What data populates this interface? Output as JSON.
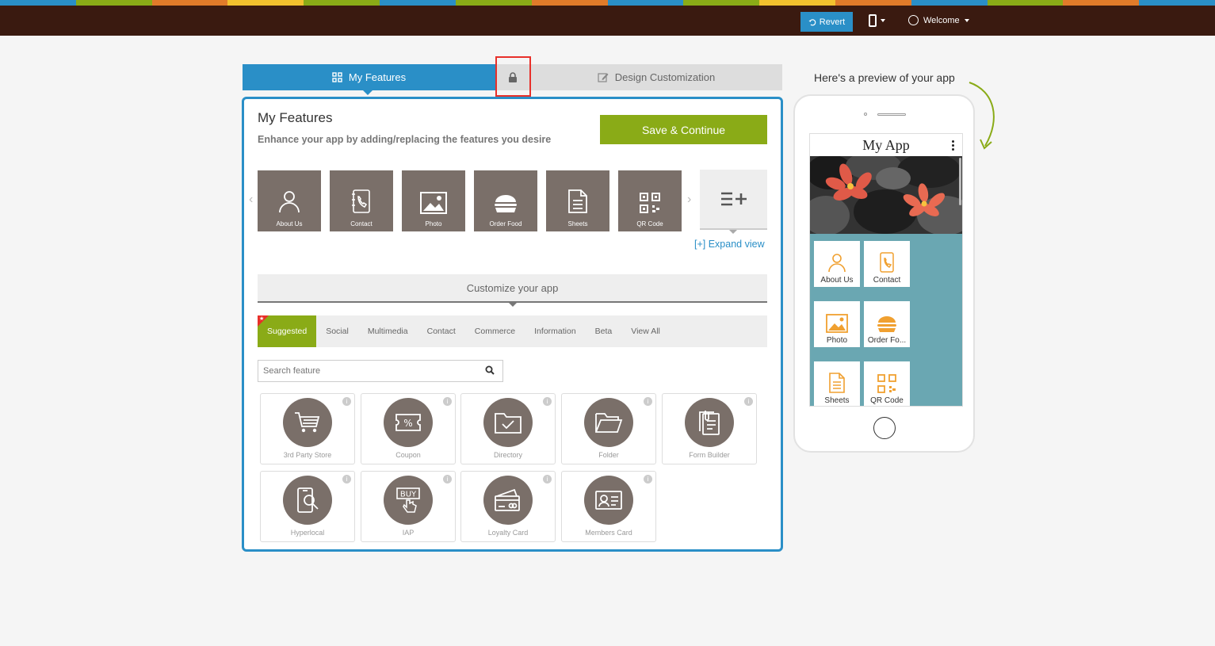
{
  "topbar": {
    "stripe_colors": [
      "#2a8fc7",
      "#8aab17",
      "#e07b2a",
      "#f2c12e",
      "#8aab17",
      "#2a8fc7",
      "#8aab17",
      "#e07b2a",
      "#2a8fc7",
      "#8aab17",
      "#f2c12e",
      "#e07b2a",
      "#2a8fc7",
      "#8aab17",
      "#e07b2a",
      "#2a8fc7"
    ],
    "revert_label": "Revert",
    "welcome_label": "Welcome"
  },
  "tabs": {
    "features_label": "My Features",
    "design_label": "Design Customization"
  },
  "panel": {
    "title": "My Features",
    "subtitle": "Enhance your app by adding/replacing the features you desire",
    "save_label": "Save & Continue",
    "expand_label": "[+] Expand view",
    "customize_label": "Customize your app",
    "search_placeholder": "Search feature"
  },
  "carousel": [
    {
      "label": "About Us",
      "icon": "user-icon"
    },
    {
      "label": "Contact",
      "icon": "phone-book-icon"
    },
    {
      "label": "Photo",
      "icon": "image-icon"
    },
    {
      "label": "Order Food",
      "icon": "burger-icon"
    },
    {
      "label": "Sheets",
      "icon": "document-icon"
    },
    {
      "label": "QR Code",
      "icon": "qr-code-icon"
    }
  ],
  "categories": [
    "Suggested",
    "Social",
    "Multimedia",
    "Contact",
    "Commerce",
    "Information",
    "Beta",
    "View All"
  ],
  "cards": [
    {
      "label": "3rd Party Store",
      "icon": "cart-icon"
    },
    {
      "label": "Coupon",
      "icon": "coupon-icon"
    },
    {
      "label": "Directory",
      "icon": "directory-icon"
    },
    {
      "label": "Folder",
      "icon": "folder-icon"
    },
    {
      "label": "Form Builder",
      "icon": "form-icon"
    },
    {
      "label": "Hyperlocal",
      "icon": "hyperlocal-icon"
    },
    {
      "label": "IAP",
      "icon": "buy-icon"
    },
    {
      "label": "Loyalty Card",
      "icon": "loyalty-card-icon"
    },
    {
      "label": "Members Card",
      "icon": "members-card-icon"
    }
  ],
  "preview": {
    "label": "Here's a preview of your app",
    "app_title": "My App",
    "tiles": [
      {
        "label": "About Us",
        "icon": "user-icon"
      },
      {
        "label": "Contact",
        "icon": "phone-book-icon"
      },
      {
        "label": "Photo",
        "icon": "image-icon"
      },
      {
        "label": "Order Fo...",
        "icon": "burger-icon"
      },
      {
        "label": "Sheets",
        "icon": "document-icon"
      },
      {
        "label": "QR Code",
        "icon": "qr-code-icon"
      }
    ]
  },
  "colors": {
    "brand_blue": "#2a8fc7",
    "brand_green": "#8aab17",
    "feature_brown": "#7a6f69",
    "topbar_dark": "#3a1a10",
    "highlight_red": "#e8302a",
    "preview_teal": "#6aa7b2",
    "tile_icon_orange": "#f0a030"
  }
}
